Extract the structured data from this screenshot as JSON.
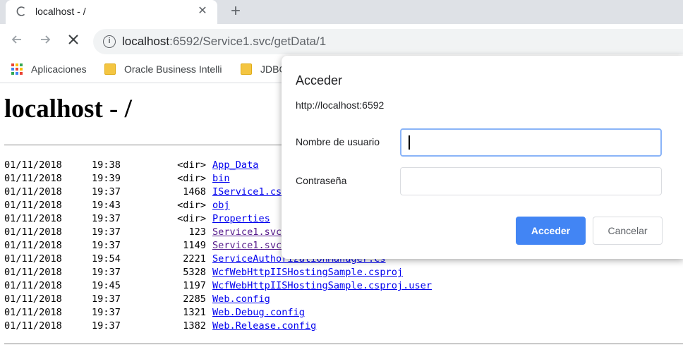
{
  "browser": {
    "tab": {
      "title": "localhost - /"
    },
    "omnibox": {
      "host": "localhost",
      "path": ":6592/Service1.svc/getData/1"
    },
    "bookmarks": [
      {
        "label": "Aplicaciones",
        "icon": "apps-grid-icon"
      },
      {
        "label": "Oracle Business Intelli",
        "icon": "folder-icon"
      },
      {
        "label": "JDBC",
        "icon": "folder-icon"
      }
    ]
  },
  "page": {
    "title": "localhost - /",
    "entries": [
      {
        "date": "01/11/2018",
        "time": "19:38",
        "size": "<dir>",
        "name": "App_Data"
      },
      {
        "date": "01/11/2018",
        "time": "19:39",
        "size": "<dir>",
        "name": "bin"
      },
      {
        "date": "01/11/2018",
        "time": "19:37",
        "size": "1468",
        "name": "IService1.cs"
      },
      {
        "date": "01/11/2018",
        "time": "19:43",
        "size": "<dir>",
        "name": "obj"
      },
      {
        "date": "01/11/2018",
        "time": "19:37",
        "size": "<dir>",
        "name": "Properties"
      },
      {
        "date": "01/11/2018",
        "time": "19:37",
        "size": "123",
        "name": "Service1.svc"
      },
      {
        "date": "01/11/2018",
        "time": "19:37",
        "size": "1149",
        "name": "Service1.svc.cs"
      },
      {
        "date": "01/11/2018",
        "time": "19:54",
        "size": "2221",
        "name": "ServiceAuthorizationManager.cs"
      },
      {
        "date": "01/11/2018",
        "time": "19:37",
        "size": "5328",
        "name": "WcfWebHttpIISHostingSample.csproj"
      },
      {
        "date": "01/11/2018",
        "time": "19:45",
        "size": "1197",
        "name": "WcfWebHttpIISHostingSample.csproj.user"
      },
      {
        "date": "01/11/2018",
        "time": "19:37",
        "size": "2285",
        "name": "Web.config"
      },
      {
        "date": "01/11/2018",
        "time": "19:37",
        "size": "1321",
        "name": "Web.Debug.config"
      },
      {
        "date": "01/11/2018",
        "time": "19:37",
        "size": "1382",
        "name": "Web.Release.config"
      }
    ]
  },
  "dialog": {
    "title": "Acceder",
    "origin": "http://localhost:6592",
    "username_label": "Nombre de usuario",
    "username_value": "",
    "password_label": "Contraseña",
    "password_value": "",
    "submit_label": "Acceder",
    "cancel_label": "Cancelar"
  },
  "colors": {
    "accent": "#4285f4",
    "link": "#0000ee",
    "visited_link": "#551a8b",
    "tabstrip": "#dee1e6",
    "focus_ring": "#8ab4f8"
  }
}
